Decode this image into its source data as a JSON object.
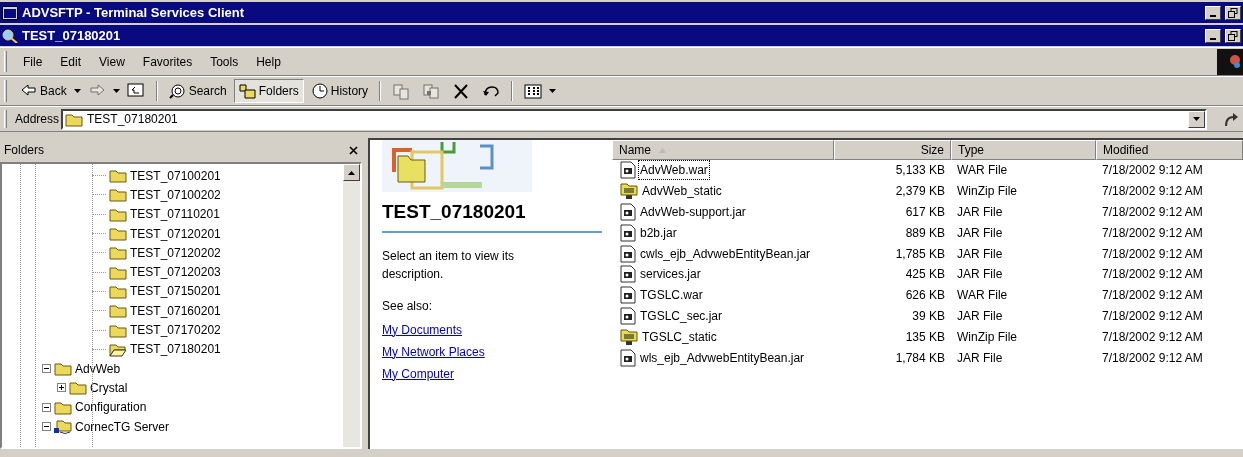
{
  "outer_window": {
    "title": "ADVSFTP - Terminal Services Client"
  },
  "explorer_window": {
    "title": "TEST_07180201"
  },
  "menu": [
    "File",
    "Edit",
    "View",
    "Favorites",
    "Tools",
    "Help"
  ],
  "toolbar": [
    {
      "kind": "text",
      "label": "Back",
      "dropdown": true,
      "disabled": false,
      "selected": false
    },
    {
      "kind": "icon",
      "dropdown": true,
      "disabled": true,
      "selected": false
    },
    {
      "kind": "icon",
      "dropdown": false,
      "disabled": false,
      "selected": false
    },
    {
      "kind": "separator"
    },
    {
      "kind": "text",
      "label": "Search",
      "dropdown": false,
      "disabled": false,
      "selected": false
    },
    {
      "kind": "text",
      "label": "Folders",
      "dropdown": false,
      "disabled": false,
      "selected": true
    },
    {
      "kind": "text",
      "label": "History",
      "dropdown": false,
      "disabled": false,
      "selected": false
    },
    {
      "kind": "separator"
    },
    {
      "kind": "icon",
      "dropdown": false,
      "disabled": true,
      "selected": false
    },
    {
      "kind": "icon",
      "dropdown": false,
      "disabled": true,
      "selected": false
    },
    {
      "kind": "icon",
      "dropdown": false,
      "disabled": false,
      "selected": false
    },
    {
      "kind": "icon",
      "dropdown": false,
      "disabled": false,
      "selected": false
    },
    {
      "kind": "separator"
    },
    {
      "kind": "icon",
      "dropdown": true,
      "disabled": false,
      "selected": false
    }
  ],
  "address": {
    "label": "Address",
    "value": "TEST_07180201"
  },
  "folders_pane": {
    "title": "Folders",
    "scrolled_branch": [
      {
        "label": "TEST_07100201",
        "kind": "folder"
      },
      {
        "label": "TEST_07100202",
        "kind": "folder"
      },
      {
        "label": "TEST_07110201",
        "kind": "folder"
      },
      {
        "label": "TEST_07120201",
        "kind": "folder"
      },
      {
        "label": "TEST_07120202",
        "kind": "folder"
      },
      {
        "label": "TEST_07120203",
        "kind": "folder"
      },
      {
        "label": "TEST_07150201",
        "kind": "folder"
      },
      {
        "label": "TEST_07160201",
        "kind": "folder"
      },
      {
        "label": "TEST_07170202",
        "kind": "folder"
      },
      {
        "label": "TEST_07180201",
        "kind": "open-folder"
      }
    ],
    "nodes": [
      {
        "label": "AdvWeb",
        "kind": "folder",
        "expanded": true,
        "children": [
          {
            "label": "Crystal",
            "kind": "folder",
            "expanded": false
          }
        ]
      },
      {
        "label": "Configuration",
        "kind": "folder",
        "expanded": true
      },
      {
        "label": "CornecTG Server",
        "kind": "server",
        "expanded": true
      }
    ]
  },
  "info_pane": {
    "title": "TEST_07180201",
    "description": "Select an item to view its description.",
    "see_also": "See also:",
    "links": [
      "My Documents",
      "My Network Places",
      "My Computer"
    ]
  },
  "file_list": {
    "columns": [
      {
        "label": "Name",
        "sorted": true
      },
      {
        "label": "Size",
        "sorted": false
      },
      {
        "label": "Type",
        "sorted": false
      },
      {
        "label": "Modified",
        "sorted": false
      }
    ],
    "rows": [
      {
        "kind": "jar",
        "focused": true,
        "name": "AdvWeb.war",
        "size": "5,133 KB",
        "type": "WAR File",
        "modified": "7/18/2002 9:12 AM"
      },
      {
        "kind": "zip",
        "focused": false,
        "name": "AdvWeb_static",
        "size": "2,379 KB",
        "type": "WinZip File",
        "modified": "7/18/2002 9:12 AM"
      },
      {
        "kind": "jar",
        "focused": false,
        "name": "AdvWeb-support.jar",
        "size": "617 KB",
        "type": "JAR File",
        "modified": "7/18/2002 9:12 AM"
      },
      {
        "kind": "jar",
        "focused": false,
        "name": "b2b.jar",
        "size": "889 KB",
        "type": "JAR File",
        "modified": "7/18/2002 9:12 AM"
      },
      {
        "kind": "jar",
        "focused": false,
        "name": "cwls_ejb_AdvwebEntityBean.jar",
        "size": "1,785 KB",
        "type": "JAR File",
        "modified": "7/18/2002 9:12 AM"
      },
      {
        "kind": "jar",
        "focused": false,
        "name": "services.jar",
        "size": "425 KB",
        "type": "JAR File",
        "modified": "7/18/2002 9:12 AM"
      },
      {
        "kind": "jar",
        "focused": false,
        "name": "TGSLC.war",
        "size": "626 KB",
        "type": "WAR File",
        "modified": "7/18/2002 9:12 AM"
      },
      {
        "kind": "jar",
        "focused": false,
        "name": "TGSLC_sec.jar",
        "size": "39 KB",
        "type": "JAR File",
        "modified": "7/18/2002 9:12 AM"
      },
      {
        "kind": "zip",
        "focused": false,
        "name": "TGSLC_static",
        "size": "135 KB",
        "type": "WinZip File",
        "modified": "7/18/2002 9:12 AM"
      },
      {
        "kind": "jar",
        "focused": false,
        "name": "wls_ejb_AdvwebEntityBean.jar",
        "size": "1,784 KB",
        "type": "JAR File",
        "modified": "7/18/2002 9:12 AM"
      }
    ]
  }
}
